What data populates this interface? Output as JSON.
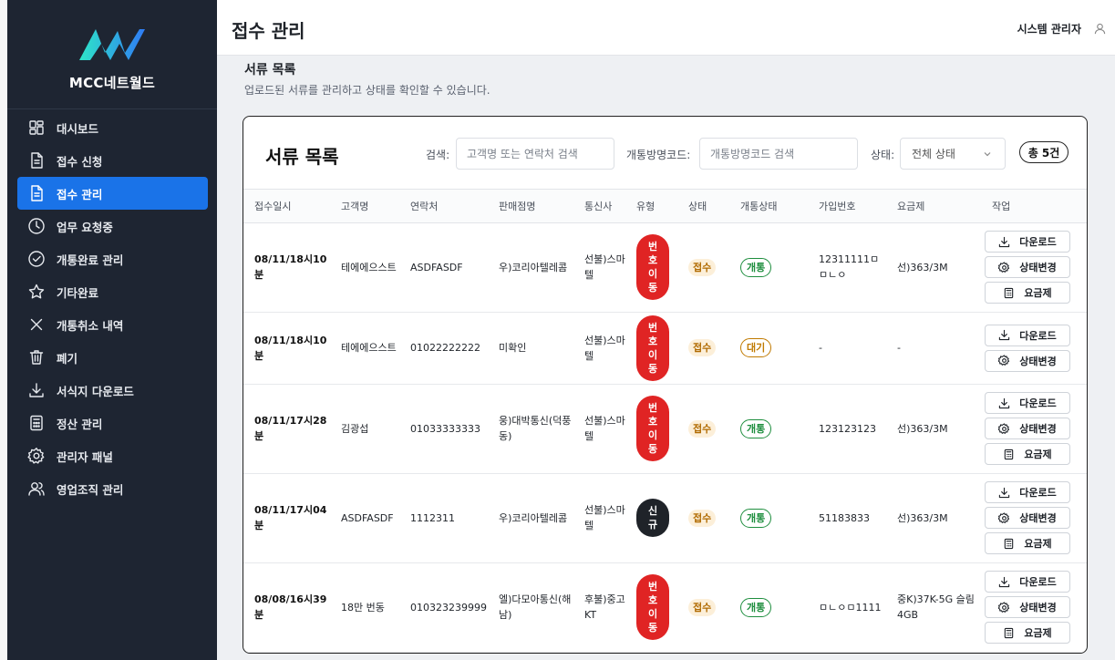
{
  "sidebar": {
    "brand": "MCC네트월드",
    "items": [
      {
        "label": "대시보드",
        "icon": "dashboard-icon"
      },
      {
        "label": "접수 신청",
        "icon": "document-icon"
      },
      {
        "label": "접수 관리",
        "icon": "document-icon",
        "active": true
      },
      {
        "label": "업무 요청중",
        "icon": "clock-icon"
      },
      {
        "label": "개통완료 관리",
        "icon": "check-circle-icon"
      },
      {
        "label": "기타완료",
        "icon": "star-icon"
      },
      {
        "label": "개통취소 내역",
        "icon": "x-icon"
      },
      {
        "label": "폐기",
        "icon": "trash-icon"
      },
      {
        "label": "서식지 다운로드",
        "icon": "download-icon"
      },
      {
        "label": "정산 관리",
        "icon": "calculator-icon"
      },
      {
        "label": "관리자 패널",
        "icon": "gear-icon"
      },
      {
        "label": "영업조직 관리",
        "icon": "users-icon"
      }
    ]
  },
  "header": {
    "title": "접수 관리",
    "user": "시스템 관리자"
  },
  "section": {
    "title": "서류 목록",
    "subtitle": "업로드된 서류를 관리하고 상태를 확인할 수 있습니다."
  },
  "card": {
    "title": "서류 목록",
    "search_label": "검색:",
    "search_placeholder": "고객명 또는 연락처 검색",
    "code_label": "개통방명코드:",
    "code_placeholder": "개통방명코드 검색",
    "status_label": "상태:",
    "status_value": "전체 상태",
    "total": "총 5건"
  },
  "table": {
    "headers": [
      "접수일시",
      "고객명",
      "연락처",
      "판매점명",
      "통신사",
      "유형",
      "상태",
      "개통상태",
      "가입번호",
      "요금제",
      "작업"
    ],
    "actions": {
      "download": "다운로드",
      "change_status": "상태변경",
      "plan": "요금제"
    },
    "rows": [
      {
        "date": "08/11/18시10분",
        "customer": "테에에으스트",
        "phone": "ASDFASDF",
        "store": "우)코리아텔레콤",
        "carrier": "선불)스마텔",
        "type": "번호이동",
        "status": "접수",
        "open": "개통",
        "signup": "12311111ㅁㅁㄴㅇ",
        "plan": "선)363/3M",
        "show_plan_button": true
      },
      {
        "date": "08/11/18시10분",
        "customer": "테에에으스트",
        "phone": "01022222222",
        "store": "미확인",
        "carrier": "선불)스마텔",
        "type": "번호이동",
        "status": "접수",
        "open": "대기",
        "signup": "-",
        "plan": "-",
        "show_plan_button": false
      },
      {
        "date": "08/11/17시28분",
        "customer": "김광섭",
        "phone": "01033333333",
        "store": "웅)대박통신(덕풍동)",
        "carrier": "선불)스마텔",
        "type": "번호이동",
        "status": "접수",
        "open": "개통",
        "signup": "123123123",
        "plan": "선)363/3M",
        "show_plan_button": true
      },
      {
        "date": "08/11/17시04분",
        "customer": "ASDFASDF",
        "phone": "1112311",
        "store": "우)코리아텔레콤",
        "carrier": "선불)스마텔",
        "type": "신규",
        "status": "접수",
        "open": "개통",
        "signup": "51183833",
        "plan": "선)363/3M",
        "show_plan_button": true
      },
      {
        "date": "08/08/16시39분",
        "customer": "18만 번동",
        "phone": "010323239999",
        "store": "엘)다모아통신(해남)",
        "carrier": "후불)중고KT",
        "type": "번호이동",
        "status": "접수",
        "open": "개통",
        "signup": "ㅁㄴㅇㅁ1111",
        "plan": "중K)37K-5G 슬림 4GB",
        "show_plan_button": true
      }
    ]
  }
}
